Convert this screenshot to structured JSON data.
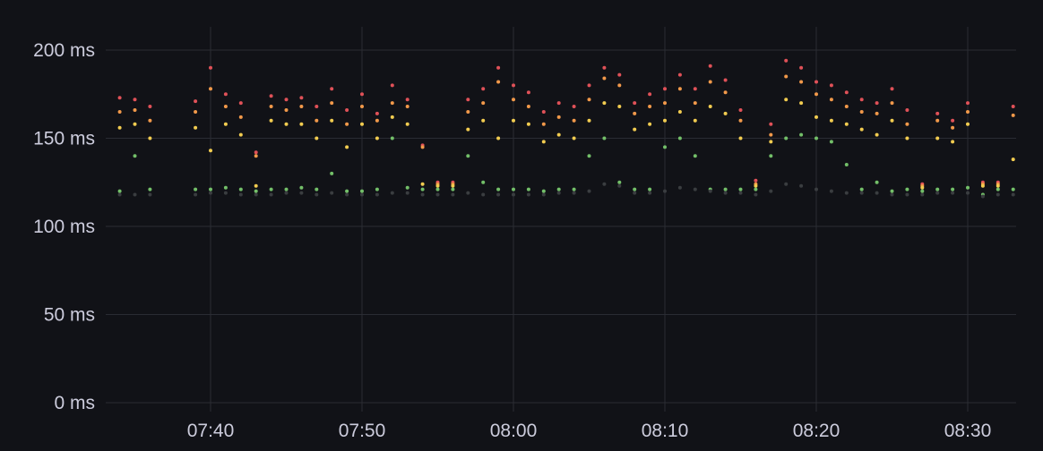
{
  "chart_data": {
    "type": "scatter",
    "title": "",
    "xlabel": "",
    "ylabel": "",
    "ylim": [
      0,
      210
    ],
    "xlim": [
      "07:33",
      "08:33"
    ],
    "grid": true,
    "legend": "none",
    "y_ticks": [
      {
        "value": 0,
        "label": "0 ms"
      },
      {
        "value": 50,
        "label": "50 ms"
      },
      {
        "value": 100,
        "label": "100 ms"
      },
      {
        "value": 150,
        "label": "150 ms"
      },
      {
        "value": 200,
        "label": "200 ms"
      }
    ],
    "x_ticks": [
      {
        "value": "07:40",
        "label": "07:40"
      },
      {
        "value": "07:50",
        "label": "07:50"
      },
      {
        "value": "08:00",
        "label": "08:00"
      },
      {
        "value": "08:10",
        "label": "08:10"
      },
      {
        "value": "08:20",
        "label": "08:20"
      },
      {
        "value": "08:30",
        "label": "08:30"
      }
    ],
    "series": [
      {
        "color": "#e05158",
        "x": [
          "07:34",
          "07:35",
          "07:36",
          "07:39",
          "07:40",
          "07:41",
          "07:42",
          "07:43",
          "07:44",
          "07:45",
          "07:46",
          "07:47",
          "07:48",
          "07:49",
          "07:50",
          "07:51",
          "07:52",
          "07:53",
          "07:54",
          "07:55",
          "07:56",
          "07:57",
          "07:58",
          "07:59",
          "08:00",
          "08:01",
          "08:02",
          "08:03",
          "08:04",
          "08:05",
          "08:06",
          "08:07",
          "08:08",
          "08:09",
          "08:10",
          "08:11",
          "08:12",
          "08:13",
          "08:14",
          "08:15",
          "08:16",
          "08:17",
          "08:18",
          "08:19",
          "08:20",
          "08:21",
          "08:22",
          "08:23",
          "08:24",
          "08:25",
          "08:26",
          "08:27",
          "08:28",
          "08:29",
          "08:30",
          "08:31",
          "08:32",
          "08:33"
        ],
        "y": [
          173,
          172,
          168,
          171,
          190,
          175,
          170,
          142,
          174,
          172,
          173,
          168,
          178,
          166,
          175,
          164,
          180,
          172,
          146,
          125,
          125,
          172,
          178,
          190,
          180,
          176,
          165,
          170,
          168,
          180,
          190,
          186,
          170,
          175,
          178,
          186,
          178,
          191,
          183,
          166,
          126,
          158,
          194,
          190,
          182,
          180,
          176,
          172,
          170,
          178,
          166,
          124,
          164,
          160,
          170,
          125,
          125,
          168
        ]
      },
      {
        "color": "#f2994a",
        "x": [
          "07:34",
          "07:35",
          "07:36",
          "07:39",
          "07:40",
          "07:41",
          "07:42",
          "07:43",
          "07:44",
          "07:45",
          "07:46",
          "07:47",
          "07:48",
          "07:49",
          "07:50",
          "07:51",
          "07:52",
          "07:53",
          "07:54",
          "07:55",
          "07:56",
          "07:57",
          "07:58",
          "07:59",
          "08:00",
          "08:01",
          "08:02",
          "08:03",
          "08:04",
          "08:05",
          "08:06",
          "08:07",
          "08:08",
          "08:09",
          "08:10",
          "08:11",
          "08:12",
          "08:13",
          "08:14",
          "08:15",
          "08:16",
          "08:17",
          "08:18",
          "08:19",
          "08:20",
          "08:21",
          "08:22",
          "08:23",
          "08:24",
          "08:25",
          "08:26",
          "08:27",
          "08:28",
          "08:29",
          "08:30",
          "08:31",
          "08:32",
          "08:33"
        ],
        "y": [
          165,
          166,
          160,
          165,
          178,
          168,
          162,
          140,
          168,
          166,
          168,
          160,
          170,
          158,
          168,
          160,
          170,
          168,
          145,
          124,
          124,
          165,
          170,
          182,
          172,
          168,
          158,
          162,
          160,
          172,
          184,
          180,
          164,
          168,
          170,
          178,
          170,
          182,
          176,
          160,
          124,
          152,
          185,
          182,
          175,
          172,
          168,
          165,
          164,
          170,
          158,
          123,
          160,
          156,
          165,
          124,
          124,
          163
        ]
      },
      {
        "color": "#f2cc50",
        "x": [
          "07:34",
          "07:35",
          "07:36",
          "07:39",
          "07:40",
          "07:41",
          "07:42",
          "07:43",
          "07:44",
          "07:45",
          "07:46",
          "07:47",
          "07:48",
          "07:49",
          "07:50",
          "07:51",
          "07:52",
          "07:53",
          "07:54",
          "07:55",
          "07:56",
          "07:57",
          "07:58",
          "07:59",
          "08:00",
          "08:01",
          "08:02",
          "08:03",
          "08:04",
          "08:05",
          "08:06",
          "08:07",
          "08:08",
          "08:09",
          "08:10",
          "08:11",
          "08:12",
          "08:13",
          "08:14",
          "08:15",
          "08:16",
          "08:17",
          "08:18",
          "08:19",
          "08:20",
          "08:21",
          "08:22",
          "08:23",
          "08:24",
          "08:25",
          "08:26",
          "08:27",
          "08:28",
          "08:29",
          "08:30",
          "08:31",
          "08:32",
          "08:33"
        ],
        "y": [
          156,
          158,
          150,
          156,
          143,
          158,
          152,
          123,
          160,
          158,
          158,
          150,
          160,
          145,
          158,
          150,
          162,
          158,
          124,
          123,
          123,
          155,
          160,
          150,
          160,
          158,
          148,
          152,
          150,
          160,
          170,
          168,
          155,
          158,
          160,
          165,
          160,
          168,
          164,
          150,
          123,
          148,
          172,
          170,
          162,
          160,
          158,
          155,
          152,
          160,
          150,
          122,
          150,
          148,
          158,
          123,
          123,
          138
        ]
      },
      {
        "color": "#73bf69",
        "x": [
          "07:34",
          "07:35",
          "07:36",
          "07:39",
          "07:40",
          "07:41",
          "07:42",
          "07:43",
          "07:44",
          "07:45",
          "07:46",
          "07:47",
          "07:48",
          "07:49",
          "07:50",
          "07:51",
          "07:52",
          "07:53",
          "07:54",
          "07:55",
          "07:56",
          "07:57",
          "07:58",
          "07:59",
          "08:00",
          "08:01",
          "08:02",
          "08:03",
          "08:04",
          "08:05",
          "08:06",
          "08:07",
          "08:08",
          "08:09",
          "08:10",
          "08:11",
          "08:12",
          "08:13",
          "08:14",
          "08:15",
          "08:16",
          "08:17",
          "08:18",
          "08:19",
          "08:20",
          "08:21",
          "08:22",
          "08:23",
          "08:24",
          "08:25",
          "08:26",
          "08:27",
          "08:28",
          "08:29",
          "08:30",
          "08:31",
          "08:32",
          "08:33"
        ],
        "y": [
          120,
          140,
          121,
          121,
          121,
          122,
          121,
          120,
          121,
          121,
          122,
          121,
          130,
          120,
          120,
          121,
          150,
          122,
          121,
          121,
          121,
          140,
          125,
          121,
          121,
          121,
          120,
          121,
          121,
          140,
          150,
          125,
          121,
          121,
          145,
          150,
          140,
          121,
          121,
          121,
          121,
          140,
          150,
          152,
          150,
          148,
          135,
          121,
          125,
          120,
          121,
          120,
          121,
          121,
          122,
          118,
          121,
          121
        ]
      },
      {
        "color": "#3a3d40",
        "x": [
          "07:34",
          "07:35",
          "07:36",
          "07:39",
          "07:40",
          "07:41",
          "07:42",
          "07:43",
          "07:44",
          "07:45",
          "07:46",
          "07:47",
          "07:48",
          "07:49",
          "07:50",
          "07:51",
          "07:52",
          "07:53",
          "07:54",
          "07:55",
          "07:56",
          "07:57",
          "07:58",
          "07:59",
          "08:00",
          "08:01",
          "08:02",
          "08:03",
          "08:04",
          "08:05",
          "08:06",
          "08:07",
          "08:08",
          "08:09",
          "08:10",
          "08:11",
          "08:12",
          "08:13",
          "08:14",
          "08:15",
          "08:16",
          "08:17",
          "08:18",
          "08:19",
          "08:20",
          "08:21",
          "08:22",
          "08:23",
          "08:24",
          "08:25",
          "08:26",
          "08:27",
          "08:28",
          "08:29",
          "08:30",
          "08:31",
          "08:32",
          "08:33"
        ],
        "y": [
          118,
          118,
          118,
          118,
          119,
          119,
          118,
          118,
          118,
          119,
          119,
          118,
          119,
          118,
          118,
          118,
          119,
          119,
          118,
          118,
          118,
          119,
          118,
          118,
          118,
          118,
          118,
          119,
          119,
          120,
          124,
          123,
          119,
          119,
          120,
          122,
          121,
          120,
          119,
          119,
          118,
          120,
          124,
          123,
          121,
          120,
          119,
          119,
          119,
          118,
          118,
          118,
          119,
          119,
          119,
          117,
          118,
          118
        ]
      }
    ]
  }
}
